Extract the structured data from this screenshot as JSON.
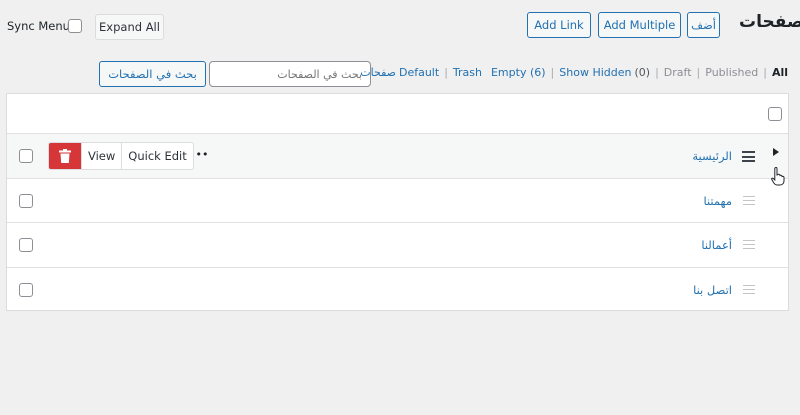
{
  "header": {
    "title": "صفحات",
    "add_button": "أضف",
    "add_multiple": "Add Multiple",
    "add_link": "Add Link",
    "expand_all": "Expand All",
    "sync_menu": "Sync Menu"
  },
  "filters": {
    "all": "All",
    "published": "Published",
    "draft": "Draft",
    "show_hidden": "Show Hidden",
    "show_hidden_count": "(0)",
    "empty": "Empty (6)",
    "trash": "Trash",
    "default": "Default",
    "pages": "صفحات"
  },
  "search": {
    "placeholder": "بحث في الصفحات",
    "button": "بحث في الصفحات"
  },
  "rows": [
    {
      "title": "الرئيسية"
    },
    {
      "title": "مهمتنا"
    },
    {
      "title": "أعمالنا"
    },
    {
      "title": "اتصل بنا"
    }
  ],
  "row_actions": {
    "view": "View",
    "quick_edit": "Quick Edit",
    "more": "•••"
  },
  "colors": {
    "accent": "#2271b1",
    "delete": "#d63638",
    "background": "#f0f0f1"
  }
}
